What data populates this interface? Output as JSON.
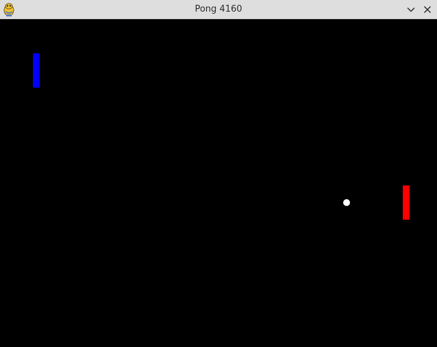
{
  "window": {
    "title": "Pong 4160",
    "icon": "pygame-snake-icon",
    "controls": [
      "minimize-chevron-icon",
      "close-icon"
    ]
  },
  "game": {
    "background_color": "#000000",
    "left_paddle_color": "#0000ff",
    "right_paddle_color": "#ff0000",
    "ball_color": "#ffffff"
  }
}
